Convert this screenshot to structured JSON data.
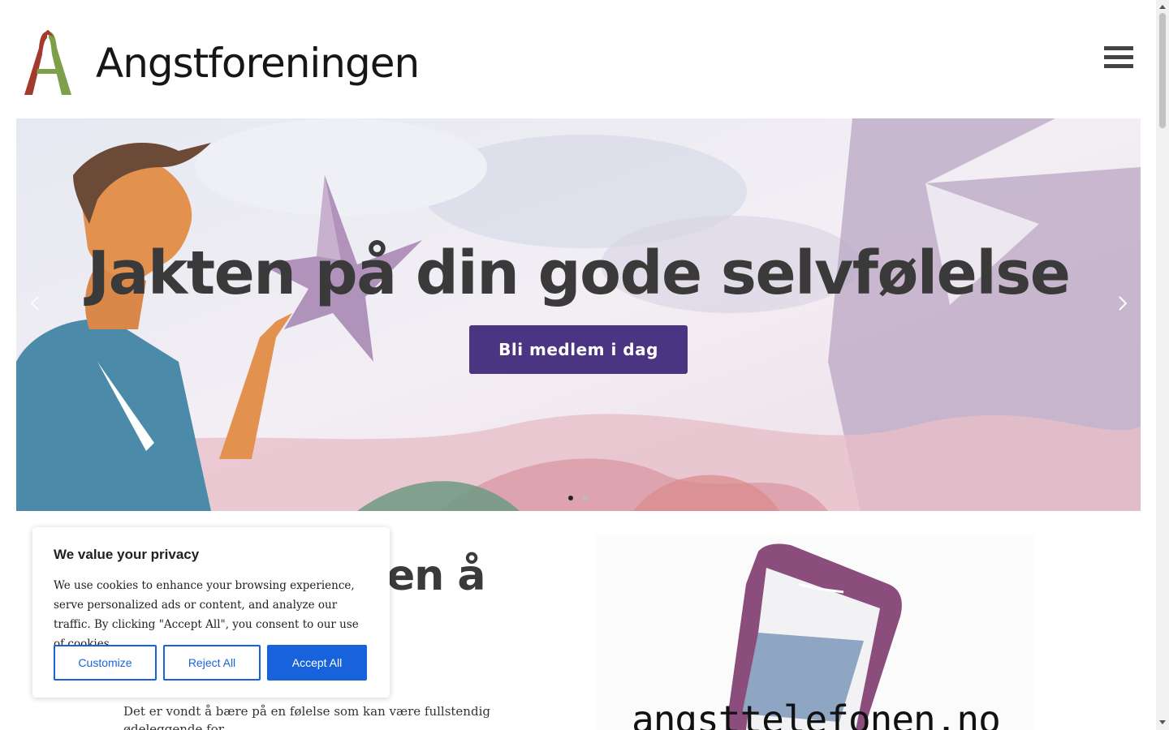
{
  "header": {
    "logo_text": "Angstforeningen",
    "menu_icon": "hamburger-menu-icon"
  },
  "hero": {
    "title": "Jakten på din gode selvfølelse",
    "cta_label": "Bli medlem i dag",
    "prev_icon": "chevron-left-icon",
    "next_icon": "chevron-right-icon",
    "slides_total": 2,
    "slide_active": 1
  },
  "content": {
    "heading_partial": "en å",
    "body_text": "Det er vondt å bære på en følelse som kan være fullstendig ødeleggende for",
    "phone_card_text": "angsttelefonen.no"
  },
  "cookie": {
    "title": "We value your privacy",
    "message": "We use cookies to enhance your browsing experience, serve personalized ads or content, and analyze our traffic. By clicking \"Accept All\", you consent to our use of cookies.",
    "customize_label": "Customize",
    "reject_label": "Reject All",
    "accept_label": "Accept All"
  },
  "colors": {
    "primary_button": "#4a3582",
    "cookie_accent": "#1863dc",
    "logo_red": "#a33a2e",
    "logo_green": "#7fa04a"
  }
}
